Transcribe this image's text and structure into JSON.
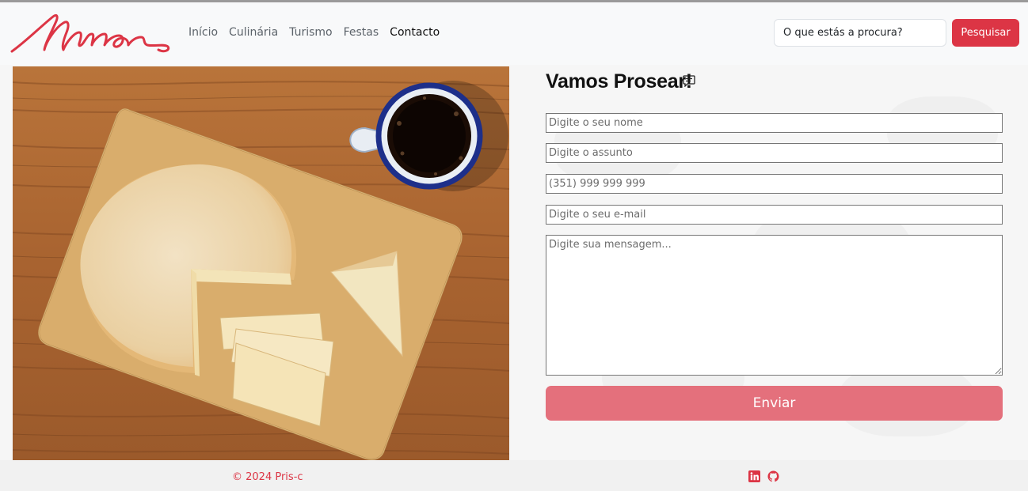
{
  "brand": {
    "logo_text": "Minas",
    "color": "#dc3545"
  },
  "nav": {
    "items": [
      {
        "label": "Início"
      },
      {
        "label": "Culinária"
      },
      {
        "label": "Turismo"
      },
      {
        "label": "Festas"
      },
      {
        "label": "Contacto"
      }
    ],
    "active": "Contacto"
  },
  "search": {
    "placeholder": "O que estás a procura?",
    "button_label": "Pesquisar"
  },
  "contact": {
    "title": "Vamos Prosear!",
    "icon": "chat-icon",
    "fields": {
      "name_placeholder": "Digite o seu nome",
      "subject_placeholder": "Digite o assunto",
      "phone_placeholder": "(351) 999 999 999",
      "email_placeholder": "Digite o seu e-mail",
      "message_placeholder": "Digite sua mensagem..."
    },
    "send_label": "Enviar"
  },
  "footer": {
    "copyright": "© 2024 Pris-c",
    "social_icons": [
      "linkedin-icon",
      "github-icon"
    ]
  },
  "colors": {
    "accent": "#dc3545",
    "send_button": "#e4707c"
  }
}
